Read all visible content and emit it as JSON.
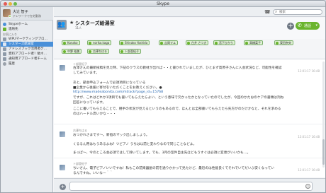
{
  "window": {
    "title": "Skype"
  },
  "profile": {
    "name": "大辻 智子",
    "mood": "テレワークで在宅勤務"
  },
  "sidebar": {
    "items": [
      {
        "label": "Skypeホーム",
        "color": "#4a90d9"
      },
      {
        "label": "連絡先",
        "color": "#6ab42d"
      }
    ],
    "section_label": "お気に入り",
    "favorites": [
      {
        "label": "WPUマーケティングプロ…",
        "color": "#8e9aa8"
      },
      {
        "label": "シスターズ給湯室",
        "color": "#8e9aa8"
      },
      {
        "label": "アドレスブック活用者グ…",
        "color": "#8e9aa8"
      },
      {
        "label": "資料アプロード者！勉ネ…",
        "color": "#8e9aa8"
      },
      {
        "label": "通知用アプロード者チーム",
        "color": "#8e9aa8"
      }
    ],
    "history_label": "履歴"
  },
  "header": {
    "search_placeholder": "検索"
  },
  "conversation": {
    "title": "シスターズ給湯室",
    "subtitle": "11人",
    "call_label": "通話",
    "participants": [
      "Kanako",
      "noriko.kaga",
      "Shinako Yoshida",
      "吉岡マユ",
      "白井 さつき",
      "宮下ひかり",
      "高橋菜子",
      "東田奈央",
      "中野 裕美",
      "古澤ちはる",
      "ト部亜紀子"
    ]
  },
  "messages": [
    {
      "sender": "ト部亜紀子",
      "time": "13:01:17 16:48",
      "lines": [
        "古澤さんの最新投稿を見た時、下記のクラスの教材が出れば・・と書かれていましたが、ひとまず高原子さんに入会状況など、可能性を確認",
        "してみています。",
        "",
        "あと、部会申込フォームで必須項目になっている",
        "■企業から後援に寄付をいただくことをお教えください。●",
        "http://www.madeabonita.com/mtrack?page_id=15768",
        "ですが、これはどれか1項目でも書いてもらえたらよい、という意味で欠かったかとなっていたのでしたが、今回のかたおのケアの書類は列ね",
        "回答になっています。",
        "ここに書いてもらえることで、相手の状況が見えるというのもあるので、ほんとは全部書いてもらえたら先方がのだけかなと、それを求める",
        "のはハードル高いかな・・・"
      ]
    },
    {
      "sender": "古澤ちはる",
      "time": "13:01:17 16:48",
      "lines": [
        "おつかれさまです〜。新宿のマック出しましょう。",
        "",
        "くるるん用はもうあるよね？ツビアノ うちは以前と変わりなので同じことなどよ。",
        "",
        "まっぱ〜、今のところ会必須ではして除いてします。でも、3月の案件自主先ほどもうすぐは必須に変更がいいかも…。"
      ]
    },
    {
      "sender": "ト部亜紀子",
      "time": "13:01:17 16:48",
      "lines": [
        "ちいさん、電子ピアノいいですね！私もこの前楽器屋の前を通りかかって見たけど、最近のは性能良くてそれでいてだいぶ安くなってい",
        "るんですね。いいなー＾＾"
      ]
    }
  ],
  "composer": {
    "placeholder": ""
  }
}
